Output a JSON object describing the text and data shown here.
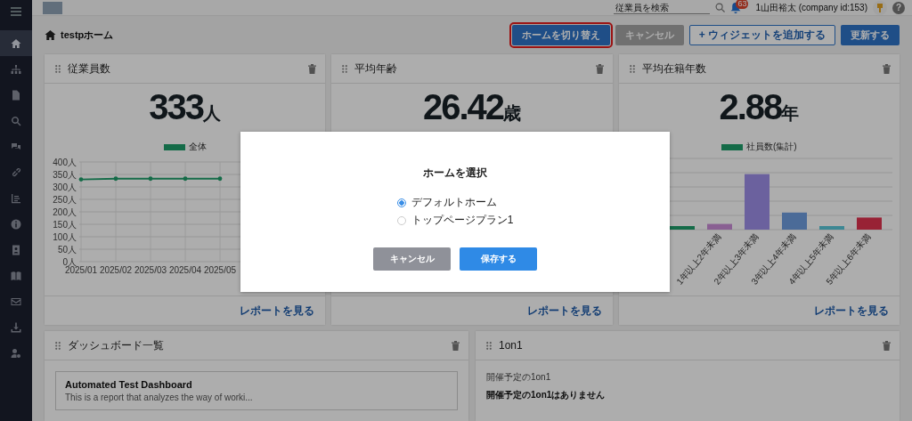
{
  "sidebar": {
    "items": [
      {
        "selected": true
      },
      {
        "selected": false
      },
      {
        "selected": false
      },
      {
        "selected": false
      },
      {
        "selected": false
      },
      {
        "selected": false
      },
      {
        "selected": false
      },
      {
        "selected": false
      },
      {
        "selected": false
      },
      {
        "selected": false
      },
      {
        "selected": false
      },
      {
        "selected": false
      },
      {
        "selected": false
      }
    ]
  },
  "topbar": {
    "search": {
      "placeholder": "従業員を検索"
    },
    "notifications": "63",
    "user": "1山田裕太 (company id:153)",
    "help": "?"
  },
  "page": {
    "title": "testpホーム"
  },
  "actions": [
    {
      "label": "ホームを切り替え",
      "kind": "primary",
      "disabled": false,
      "highlighted": true
    },
    {
      "label": "キャンセル",
      "kind": "secondary",
      "disabled": true,
      "highlighted": false
    },
    {
      "label": "+ ウィジェットを追加する",
      "kind": "outline",
      "disabled": false,
      "highlighted": false
    },
    {
      "label": "更新する",
      "kind": "primary",
      "disabled": false,
      "highlighted": false
    }
  ],
  "widgets": [
    {
      "title": "従業員数",
      "value": "333",
      "unit": "人",
      "kind": "line",
      "link": "レポートを見る",
      "chart_data": {
        "type": "line",
        "categories": [
          "2025/01",
          "2025/02",
          "2025/03",
          "2025/04",
          "2025/05"
        ],
        "series": [
          {
            "name": "全体",
            "color": "#1e9e6a",
            "values": [
              330,
              333,
              333,
              333,
              333
            ]
          }
        ],
        "ylim": [
          0,
          400
        ],
        "grid": true,
        "yticks": [
          {
            "value": 0,
            "label": "0人"
          },
          {
            "value": 50,
            "label": "50人"
          },
          {
            "value": 100,
            "label": "100人"
          },
          {
            "value": 150,
            "label": "150人"
          },
          {
            "value": 200,
            "label": "200人"
          },
          {
            "value": 250,
            "label": "250人"
          },
          {
            "value": 300,
            "label": "300人"
          },
          {
            "value": 350,
            "label": "350人"
          },
          {
            "value": 400,
            "label": "400人"
          }
        ]
      }
    },
    {
      "title": "平均年齢",
      "value": "26.42",
      "unit": "歳",
      "kind": "hidden",
      "link": "レポートを見る"
    },
    {
      "title": "平均在籍年数",
      "value": "2.88",
      "unit": "年",
      "kind": "bar",
      "legend": "社員数(集計)",
      "link": "レポートを見る",
      "category_labels": [
        "1年以上2年未満",
        "2年以上3年未満",
        "3年以上4年未満",
        "4年以上5年未満",
        "5年以上6年未満"
      ]
    }
  ],
  "dashboards": {
    "title": "ダッシュボード一覧",
    "items": [
      {
        "name": "Automated Test Dashboard",
        "description": "This is a report that analyzes the way of worki..."
      }
    ]
  },
  "one_on_one": {
    "title": "1on1",
    "section": "開催予定の1on1",
    "empty": "開催予定の1on1はありません"
  },
  "modal": {
    "title": "ホームを選択",
    "options": [
      {
        "label": "デフォルトホーム",
        "selected": true
      },
      {
        "label": "トップページプラン1",
        "selected": false
      }
    ],
    "cancel": "キャンセル",
    "save": "保存する"
  }
}
